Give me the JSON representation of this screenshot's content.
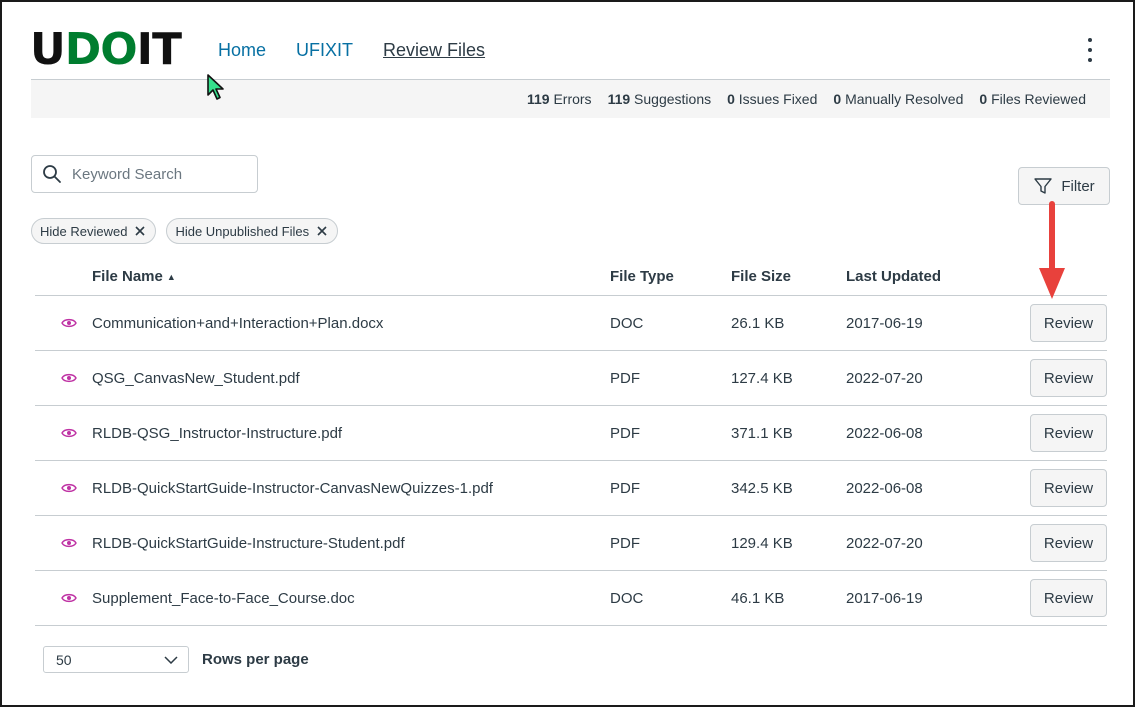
{
  "app": {
    "logo_text_pre": "U",
    "logo_text_green": "DO",
    "logo_text_post": "IT"
  },
  "nav": {
    "items": [
      {
        "label": "Home"
      },
      {
        "label": "UFIXIT"
      },
      {
        "label": "Review Files"
      }
    ],
    "active": "Review Files"
  },
  "summary": {
    "errors_count": "119",
    "errors_label": "Errors",
    "suggestions_count": "119",
    "suggestions_label": "Suggestions",
    "fixed_count": "0",
    "fixed_label": "Issues Fixed",
    "manual_count": "0",
    "manual_label": "Manually Resolved",
    "reviewed_count": "0",
    "reviewed_label": "Files Reviewed"
  },
  "search": {
    "placeholder": "Keyword Search",
    "value": ""
  },
  "filter": {
    "label": "Filter"
  },
  "chips": [
    {
      "label": "Hide Reviewed"
    },
    {
      "label": "Hide Unpublished Files"
    }
  ],
  "table": {
    "headers": {
      "name": "File Name",
      "type": "File Type",
      "size": "File Size",
      "updated": "Last Updated"
    },
    "sort": {
      "column": "name",
      "direction": "ascending"
    },
    "rows": [
      {
        "name": "Communication+and+Interaction+Plan.docx",
        "type": "DOC",
        "size": "26.1 KB",
        "updated": "2017-06-19",
        "action": "Review"
      },
      {
        "name": "QSG_CanvasNew_Student.pdf",
        "type": "PDF",
        "size": "127.4 KB",
        "updated": "2022-07-20",
        "action": "Review"
      },
      {
        "name": "RLDB-QSG_Instructor-Instructure.pdf",
        "type": "PDF",
        "size": "371.1 KB",
        "updated": "2022-06-08",
        "action": "Review"
      },
      {
        "name": "RLDB-QuickStartGuide-Instructor-CanvasNewQuizzes-1.pdf",
        "type": "PDF",
        "size": "342.5 KB",
        "updated": "2022-06-08",
        "action": "Review"
      },
      {
        "name": "RLDB-QuickStartGuide-Instructure-Student.pdf",
        "type": "PDF",
        "size": "129.4 KB",
        "updated": "2022-07-20",
        "action": "Review"
      },
      {
        "name": "Supplement_Face-to-Face_Course.doc",
        "type": "DOC",
        "size": "46.1 KB",
        "updated": "2017-06-19",
        "action": "Review"
      }
    ]
  },
  "pagination": {
    "rows_per_page_value": "50",
    "rows_per_page_label": "Rows per page"
  },
  "colors": {
    "logo_green": "#007d2f",
    "nav_link": "#0770a3",
    "eye_icon": "#bf32a4",
    "annotation_arrow": "#e8413c"
  }
}
